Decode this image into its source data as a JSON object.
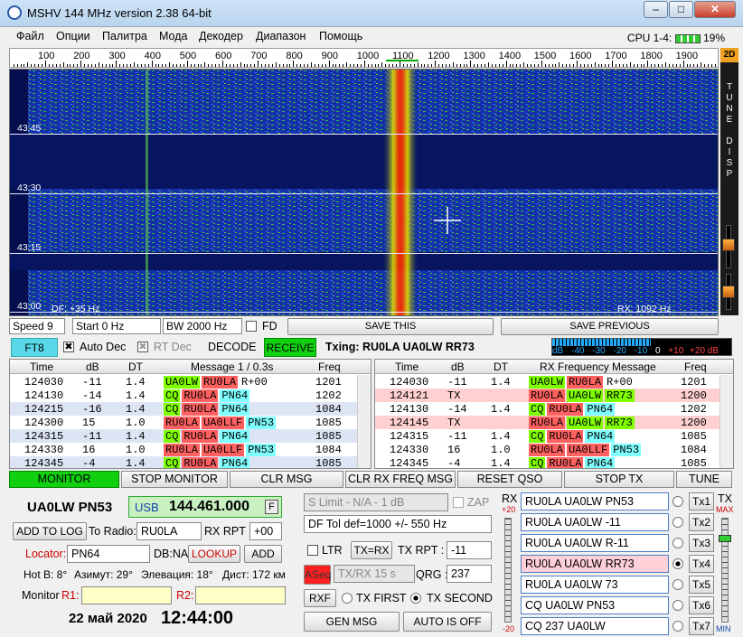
{
  "window": {
    "title": "MSHV 144 MHz version 2.38 64-bit",
    "min": "0",
    "max": "1",
    "close": "r"
  },
  "menu": [
    "Файл",
    "Опции",
    "Палитра",
    "Мода",
    "Декодер",
    "Диапазон",
    "Помощь"
  ],
  "cpu": "CPU 1-4:",
  "cpu_pct": "19%",
  "ruler": {
    "labels": [
      "100",
      "200",
      "300",
      "400",
      "500",
      "600",
      "700",
      "800",
      "900",
      "1000",
      "1100",
      "1200",
      "1300",
      "1400",
      "1500",
      "1600",
      "1700",
      "1800",
      "1900"
    ]
  },
  "waterfall": {
    "times": [
      "43:45",
      "43:30",
      "43:15",
      "43:00"
    ],
    "df": "DF: +35 Hz",
    "rx": "RX: 1092 Hz"
  },
  "side": {
    "mode": "2D",
    "letters": [
      "T",
      "U",
      "N",
      "E",
      "",
      "D",
      "I",
      "S",
      "P"
    ]
  },
  "controls": {
    "speed": "Speed 9",
    "start": "Start 0 Hz",
    "bw": "BW 2000 Hz",
    "fd": "FD",
    "save_this": "SAVE THIS",
    "save_previous": "SAVE PREVIOUS"
  },
  "mode": {
    "ft8": "FT8",
    "auto_dec": "Auto Dec",
    "rt_dec": "RT Dec",
    "decode": "DECODE",
    "receive": "RECEIVE",
    "txing": "Txing: RU0LA UA0LW RR73"
  },
  "meter": {
    "labels": [
      "dB",
      "-40",
      "-30",
      "-20",
      "-10",
      "0",
      "+10",
      "+20 dB"
    ],
    "level": 0.55
  },
  "left_table": {
    "headers": [
      "Time",
      "dB",
      "DT",
      "Message 1 / 0.3s",
      "Freq"
    ],
    "rows": [
      {
        "time": "124030",
        "db": "-11",
        "dt": "1.4",
        "msg": [
          [
            "UA0LW",
            "g"
          ],
          [
            "RU0LA",
            "r"
          ],
          [
            "R+00",
            "n"
          ]
        ],
        "freq": "1201",
        "bg": "#ffffff"
      },
      {
        "time": "124130",
        "db": "-14",
        "dt": "1.4",
        "msg": [
          [
            "CQ",
            "g"
          ],
          [
            "RU0LA",
            "r"
          ],
          [
            "PN64",
            "c"
          ]
        ],
        "freq": "1202",
        "bg": "#ffffff"
      },
      {
        "time": "124215",
        "db": "-16",
        "dt": "1.4",
        "msg": [
          [
            "CQ",
            "g"
          ],
          [
            "RU0LA",
            "r"
          ],
          [
            "PN64",
            "c"
          ]
        ],
        "freq": "1084",
        "bg": "#dde5f5"
      },
      {
        "time": "124300",
        "db": "15",
        "dt": "1.0",
        "msg": [
          [
            "RU0LA",
            "r"
          ],
          [
            "UA0LLF",
            "r"
          ],
          [
            "PN53",
            "c"
          ]
        ],
        "freq": "1085",
        "bg": "#ffffff"
      },
      {
        "time": "124315",
        "db": "-11",
        "dt": "1.4",
        "msg": [
          [
            "CQ",
            "g"
          ],
          [
            "RU0LA",
            "r"
          ],
          [
            "PN64",
            "c"
          ]
        ],
        "freq": "1085",
        "bg": "#dde5f5"
      },
      {
        "time": "124330",
        "db": "16",
        "dt": "1.0",
        "msg": [
          [
            "RU0LA",
            "r"
          ],
          [
            "UA0LLF",
            "r"
          ],
          [
            "PN53",
            "c"
          ]
        ],
        "freq": "1084",
        "bg": "#ffffff"
      },
      {
        "time": "124345",
        "db": "-4",
        "dt": "1.4",
        "msg": [
          [
            "CQ",
            "g"
          ],
          [
            "RU0LA",
            "r"
          ],
          [
            "PN64",
            "c"
          ]
        ],
        "freq": "1085",
        "bg": "#dde5f5"
      }
    ]
  },
  "right_table": {
    "headers": [
      "Time",
      "dB",
      "DT",
      "RX Frequency Message",
      "Freq"
    ],
    "rows": [
      {
        "time": "124030",
        "db": "-11",
        "dt": "1.4",
        "msg": [
          [
            "UA0LW",
            "g"
          ],
          [
            "RU0LA",
            "r"
          ],
          [
            "R+00",
            "n"
          ]
        ],
        "freq": "1201",
        "bg": "#ffffff"
      },
      {
        "time": "124121",
        "db": "TX",
        "dt": "",
        "msg": [
          [
            "RU0LA",
            "r"
          ],
          [
            "UA0LW",
            "g"
          ],
          [
            "RR73",
            "g"
          ]
        ],
        "freq": "1200",
        "bg": "#ffd0d0"
      },
      {
        "time": "124130",
        "db": "-14",
        "dt": "1.4",
        "msg": [
          [
            "CQ",
            "g"
          ],
          [
            "RU0LA",
            "r"
          ],
          [
            "PN64",
            "c"
          ]
        ],
        "freq": "1202",
        "bg": "#ffffff"
      },
      {
        "time": "124145",
        "db": "TX",
        "dt": "",
        "msg": [
          [
            "RU0LA",
            "r"
          ],
          [
            "UA0LW",
            "g"
          ],
          [
            "RR73",
            "g"
          ]
        ],
        "freq": "1200",
        "bg": "#ffd0d0"
      },
      {
        "time": "124315",
        "db": "-11",
        "dt": "1.4",
        "msg": [
          [
            "CQ",
            "g"
          ],
          [
            "RU0LA",
            "r"
          ],
          [
            "PN64",
            "c"
          ]
        ],
        "freq": "1085",
        "bg": "#ffffff"
      },
      {
        "time": "124330",
        "db": "16",
        "dt": "1.0",
        "msg": [
          [
            "RU0LA",
            "r"
          ],
          [
            "UA0LLF",
            "r"
          ],
          [
            "PN53",
            "c"
          ]
        ],
        "freq": "1084",
        "bg": "#ffffff"
      },
      {
        "time": "124345",
        "db": "-4",
        "dt": "1.4",
        "msg": [
          [
            "CQ",
            "g"
          ],
          [
            "RU0LA",
            "r"
          ],
          [
            "PN64",
            "c"
          ]
        ],
        "freq": "1085",
        "bg": "#ffffff"
      }
    ]
  },
  "buttons": {
    "monitor": "MONITOR",
    "stop_monitor": "STOP MONITOR",
    "clr_msg": "CLR MSG",
    "clr_rx": "CLR RX FREQ MSG",
    "reset_qso": "RESET QSO",
    "stop_tx": "STOP TX",
    "tune": "TUNE"
  },
  "station": {
    "call_grid": "UA0LW PN53",
    "band": "USB",
    "freq": "144.461.000",
    "f": "F",
    "add_log": "ADD TO LOG",
    "to_radio": "To Radio:",
    "to_radio_val": "RU0LA",
    "rx_rpt_label": "RX RPT :",
    "rx_rpt": "+00",
    "locator_label": "Locator:",
    "locator": "PN64",
    "dbna": "DB:NA",
    "lookup": "LOOKUP",
    "add": "ADD",
    "hotb": "Hot B: 8°",
    "azimuth": "Азимут: 29°",
    "elev": "Элевация: 18°",
    "dist": "Дист: 172 км",
    "monitor_label": "Monitor",
    "r1": "R1:",
    "r2": "R2:",
    "date": "22 май 2020",
    "time": "12:44:00"
  },
  "mid": {
    "slimit": "S Limit - N/A - 1  dB",
    "zap": "ZAP",
    "dftol": "DF Tol def=1000 +/-  550  Hz",
    "ltr": "LTR",
    "txrx": "TX=RX",
    "tx_rpt_label": "TX RPT :",
    "tx_rpt": "-11",
    "aseq": "ASeq",
    "txrx15": "TX/RX 15  s",
    "qrg_label": "QRG :",
    "qrg": "237",
    "rxf": "RXF",
    "tx_first": "TX FIRST",
    "tx_second": "TX SECOND",
    "gen_msg": "GEN MSG",
    "auto_off": "AUTO IS OFF"
  },
  "rxcol": {
    "rx": "RX",
    "plus": "+20",
    "minus": "-20",
    "tx": "TX",
    "max": "MAX",
    "min": "MIN"
  },
  "tx": [
    {
      "msg": "RU0LA UA0LW PN53",
      "btn": "Tx1",
      "sel": false
    },
    {
      "msg": "RU0LA UA0LW -11",
      "btn": "Tx2",
      "sel": false
    },
    {
      "msg": "RU0LA UA0LW R-11",
      "btn": "Tx3",
      "sel": false
    },
    {
      "msg": "RU0LA UA0LW RR73",
      "btn": "Tx4",
      "sel": true
    },
    {
      "msg": "RU0LA UA0LW 73",
      "btn": "Tx5",
      "sel": false
    },
    {
      "msg": "CQ UA0LW PN53",
      "btn": "Tx6",
      "sel": false
    },
    {
      "msg": "CQ 237 UA0LW",
      "btn": "Tx7",
      "sel": false
    }
  ]
}
